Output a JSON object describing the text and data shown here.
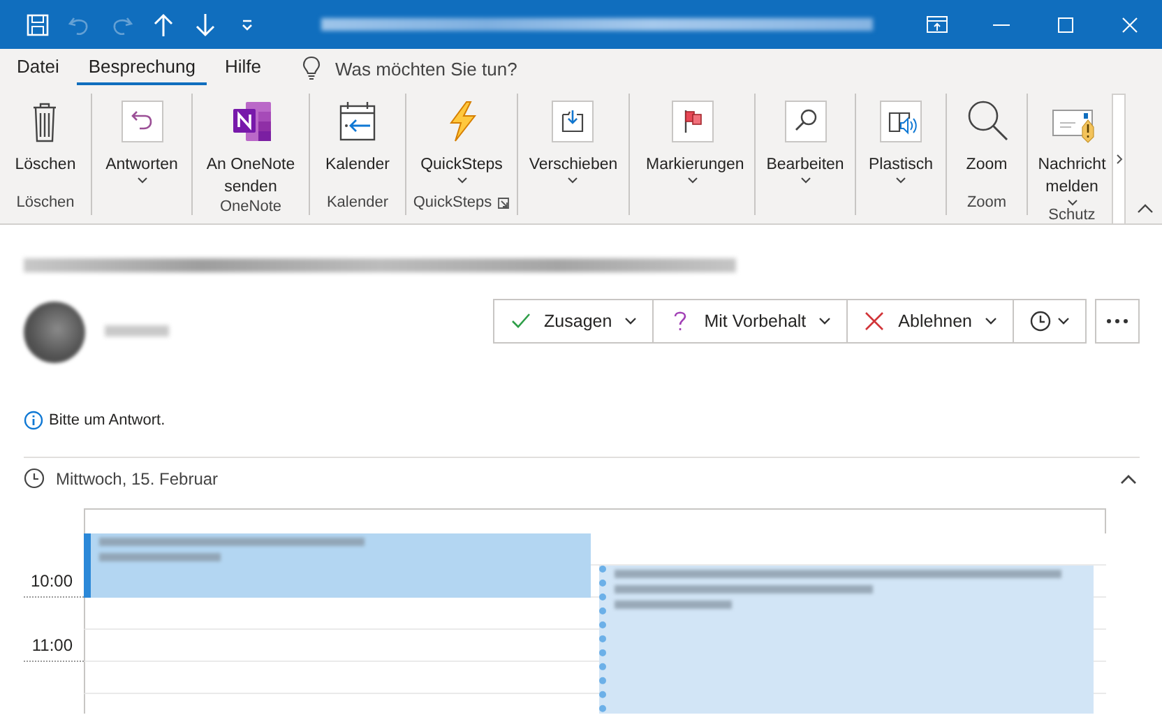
{
  "quick_access": [
    {
      "disabled": false
    },
    {
      "disabled": true
    },
    {
      "disabled": true
    },
    {
      "disabled": false
    },
    {
      "disabled": false
    },
    {
      "disabled": false
    }
  ],
  "tabs": [
    {
      "label": "Datei",
      "selected": false
    },
    {
      "label": "Besprechung",
      "selected": true
    },
    {
      "label": "Hilfe",
      "selected": false
    }
  ],
  "tell_me": {
    "placeholder": "Was möchten Sie tun?"
  },
  "ribbon": {
    "groups": [
      {
        "label": "Löschen",
        "buttons": [
          {
            "label": "Löschen",
            "has_menu": false
          }
        ]
      },
      {
        "buttons": [
          {
            "label": "Antworten",
            "has_menu": true
          }
        ]
      },
      {
        "label": "OneNote",
        "buttons": [
          {
            "label": "An OneNote senden",
            "has_menu": false
          }
        ]
      },
      {
        "label": "Kalender",
        "buttons": [
          {
            "label": "Kalender",
            "has_menu": false
          }
        ]
      },
      {
        "label": "QuickSteps",
        "launcher": true,
        "buttons": [
          {
            "label": "QuickSteps",
            "has_menu": true
          }
        ]
      },
      {
        "buttons": [
          {
            "label": "Verschieben",
            "has_menu": true
          }
        ]
      },
      {
        "buttons": [
          {
            "label": "Markierungen",
            "has_menu": true
          }
        ]
      },
      {
        "buttons": [
          {
            "label": "Bearbeiten",
            "has_menu": true
          }
        ]
      },
      {
        "buttons": [
          {
            "label": "Plastisch",
            "has_menu": true
          }
        ]
      },
      {
        "label": "Zoom",
        "buttons": [
          {
            "label": "Zoom",
            "has_menu": false
          }
        ]
      },
      {
        "label": "Schutz",
        "buttons": [
          {
            "label": "Nachricht melden",
            "has_menu": true
          }
        ]
      }
    ]
  },
  "response_buttons": [
    {
      "kind": "accept",
      "label": "Zusagen"
    },
    {
      "kind": "tentative",
      "label": "Mit Vorbehalt"
    },
    {
      "kind": "decline",
      "label": "Ablehnen"
    },
    {
      "kind": "propose"
    }
  ],
  "info": "Bitte um Antwort.",
  "day": {
    "label": "Mittwoch, 15. Februar",
    "expanded": true
  },
  "calendar": {
    "times": [
      "10:00",
      "11:00"
    ],
    "appointments": [
      {
        "tentative": false
      },
      {
        "tentative": true
      }
    ]
  }
}
